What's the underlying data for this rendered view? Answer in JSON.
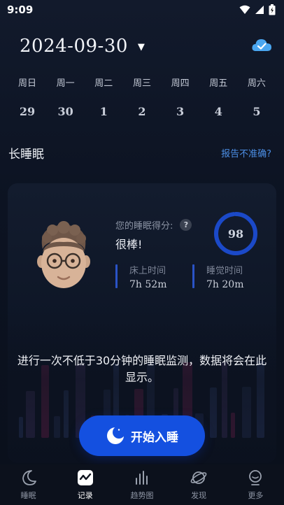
{
  "status_bar": {
    "time": "9:09"
  },
  "header": {
    "date": "2024-09-30"
  },
  "week": {
    "days": [
      "周日",
      "周一",
      "周二",
      "周三",
      "周四",
      "周五",
      "周六"
    ],
    "dates": [
      "29",
      "30",
      "1",
      "2",
      "3",
      "4",
      "5"
    ]
  },
  "section": {
    "title": "长睡眠",
    "report_link": "报告不准确?"
  },
  "summary": {
    "score_label": "您的睡眠得分:",
    "help": "?",
    "score_word": "很棒!",
    "score": "98",
    "score_fraction": 0.98,
    "bed_time_label": "床上时间",
    "bed_time_value": "7h 52m",
    "sleep_time_label": "睡觉时间",
    "sleep_time_value": "7h 20m"
  },
  "notice": "进行一次不低于30分钟的睡眠监测，数据将会在此显示。",
  "start_button": {
    "label": "开始入睡"
  },
  "tabs": [
    {
      "label": "睡眠",
      "icon": "moon-icon"
    },
    {
      "label": "记录",
      "icon": "record-icon"
    },
    {
      "label": "趋势图",
      "icon": "bar-chart-icon"
    },
    {
      "label": "发现",
      "icon": "planet-icon"
    },
    {
      "label": "更多",
      "icon": "more-icon"
    }
  ],
  "colors": {
    "accent": "#1450e0",
    "link": "#4c8fe6",
    "ring": "#1b49c8"
  }
}
